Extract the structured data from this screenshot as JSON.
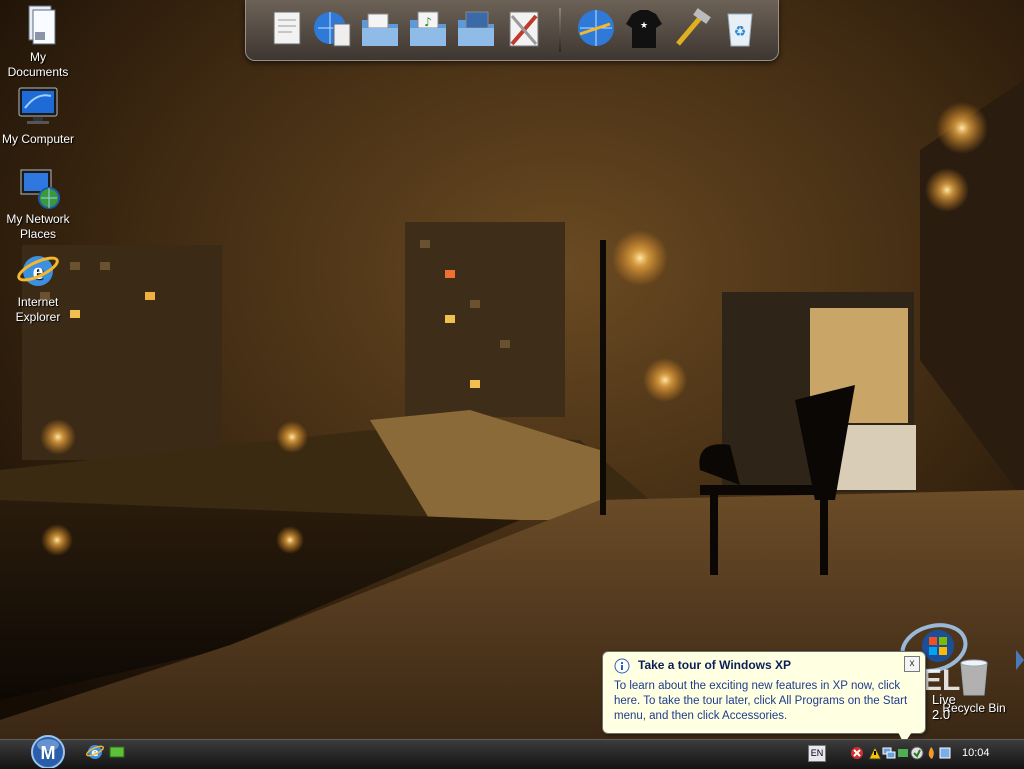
{
  "desktop": {
    "icons": [
      {
        "label": "My Documents"
      },
      {
        "label": "My Computer"
      },
      {
        "label": "My Network Places"
      },
      {
        "label": "Internet Explorer"
      },
      {
        "label": "Recycle Bin"
      }
    ]
  },
  "dock": {
    "items": [
      {
        "icon": "document-icon"
      },
      {
        "icon": "globe-document-icon"
      },
      {
        "icon": "folder-documents-icon"
      },
      {
        "icon": "folder-music-icon"
      },
      {
        "icon": "folder-pictures-icon"
      },
      {
        "icon": "tools-settings-icon"
      },
      {
        "icon": "internet-globe-icon"
      },
      {
        "icon": "tshirt-icon"
      },
      {
        "icon": "hammer-tools-icon"
      },
      {
        "icon": "recycle-bin-icon"
      }
    ]
  },
  "windows_live": {
    "text": "Live 2.0"
  },
  "balloon": {
    "title": "Take a tour of Windows XP",
    "body": "To learn about the exciting new features in XP now, click here. To take the tour later, click All Programs on the Start menu, and then click Accessories.",
    "close": "x"
  },
  "taskbar": {
    "start_letter": "M",
    "language": "EN",
    "clock": "10:04"
  }
}
